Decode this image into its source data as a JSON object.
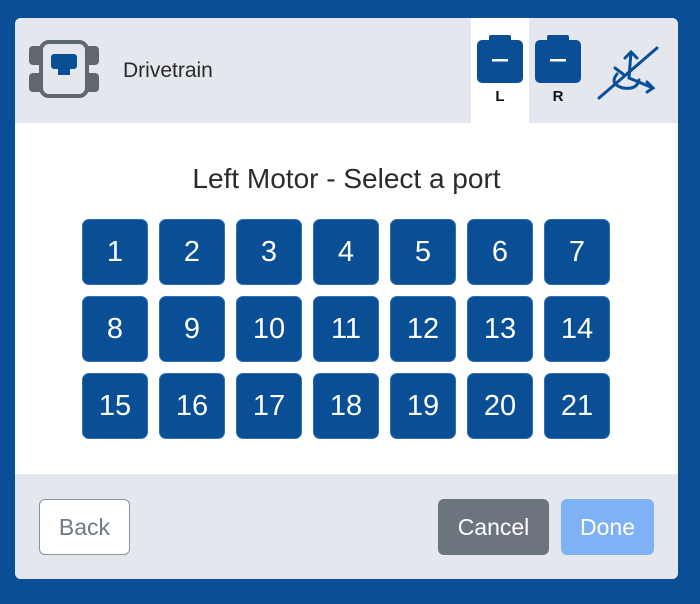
{
  "header": {
    "device_icon": "drivetrain-icon",
    "title": "Drivetrain",
    "tabs": [
      {
        "label": "L",
        "icon": "motor-icon",
        "active": true
      },
      {
        "label": "R",
        "icon": "motor-icon",
        "active": false
      }
    ],
    "gyro_icon": "gyro-disabled-icon"
  },
  "main": {
    "prompt": "Left Motor - Select a port",
    "ports": [
      "1",
      "2",
      "3",
      "4",
      "5",
      "6",
      "7",
      "8",
      "9",
      "10",
      "11",
      "12",
      "13",
      "14",
      "15",
      "16",
      "17",
      "18",
      "19",
      "20",
      "21"
    ]
  },
  "footer": {
    "back_label": "Back",
    "cancel_label": "Cancel",
    "done_label": "Done"
  },
  "colors": {
    "brand": "#0a4f96",
    "panel": "#e5e7ee",
    "cancel": "#6c757d",
    "done_disabled": "#7fb2f4"
  }
}
